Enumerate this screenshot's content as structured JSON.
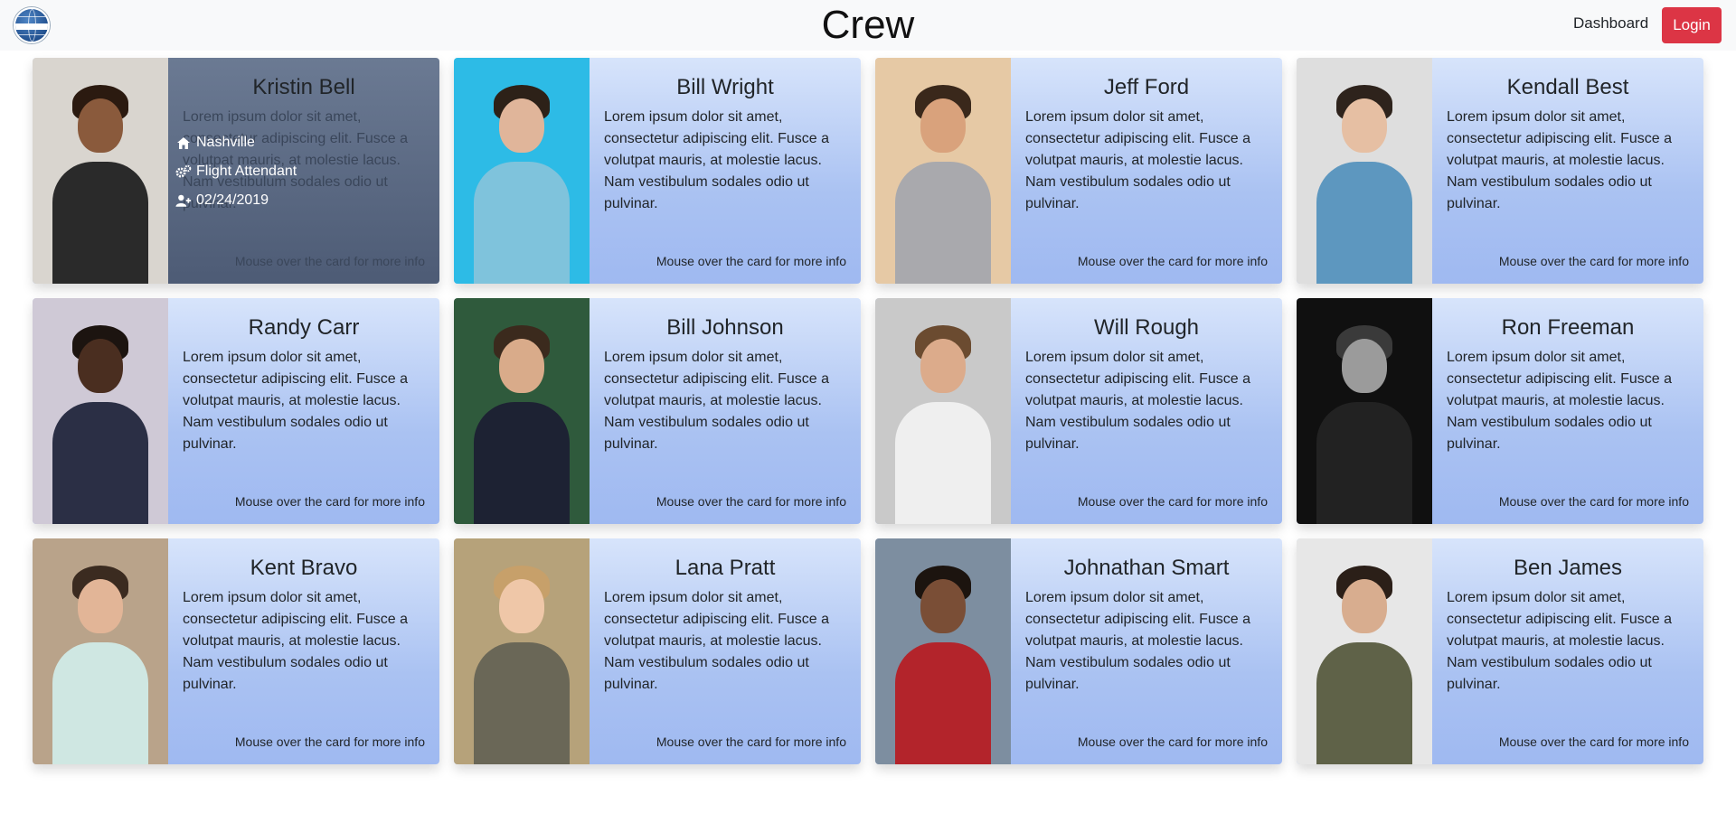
{
  "nav": {
    "title": "Crew",
    "dashboard_label": "Dashboard",
    "login_label": "Login",
    "logo_icon": "pan-am-globe-icon"
  },
  "card_common": {
    "bio": "Lorem ipsum dolor sit amet, consectetur adipiscing elit. Fusce a volutpat mauris, at molestie lacus. Nam vestibulum sodales odio ut pulvinar.",
    "hint": "Mouse over the card for more info"
  },
  "crew": [
    {
      "name": "Kristin Bell",
      "skin": "#8a5a3c",
      "hair": "#2b1a10",
      "shirt": "#2a2a2a",
      "bg": "#d9d5cf",
      "details": {
        "city": "Nashville",
        "role": "Flight Attendant",
        "date": "02/24/2019"
      }
    },
    {
      "name": "Bill Wright",
      "skin": "#e0b59a",
      "hair": "#2d2118",
      "shirt": "#7fc3dc",
      "bg": "#2dbbe6"
    },
    {
      "name": "Jeff Ford",
      "skin": "#d9a27c",
      "hair": "#3a281b",
      "shirt": "#a9a9ad",
      "bg": "#e6c9a5"
    },
    {
      "name": "Kendall Best",
      "skin": "#e6bfa3",
      "hair": "#2e231c",
      "shirt": "#5d97bf",
      "bg": "#dedede"
    },
    {
      "name": "Randy Carr",
      "skin": "#4a2e20",
      "hair": "#1c1410",
      "shirt": "#2b2f45",
      "bg": "#cfc9d6"
    },
    {
      "name": "Bill Johnson",
      "skin": "#d9ab8a",
      "hair": "#3b2a1d",
      "shirt": "#1d2233",
      "bg": "#2f5a3c"
    },
    {
      "name": "Will Rough",
      "skin": "#dcab8b",
      "hair": "#6b4b30",
      "shirt": "#efefef",
      "bg": "#c9c9c9"
    },
    {
      "name": "Ron Freeman",
      "skin": "#9b9b9b",
      "hair": "#3a3a3a",
      "shirt": "#222222",
      "bg": "#101010"
    },
    {
      "name": "Kent Bravo",
      "skin": "#e2b597",
      "hair": "#3b2b20",
      "shirt": "#cfe7e2",
      "bg": "#b9a38a"
    },
    {
      "name": "Lana Pratt",
      "skin": "#efc7a8",
      "hair": "#c7a06a",
      "shirt": "#6a6757",
      "bg": "#b6a27a"
    },
    {
      "name": "Johnathan Smart",
      "skin": "#7a4e36",
      "hair": "#1c140f",
      "shirt": "#b3242b",
      "bg": "#7d8ea0"
    },
    {
      "name": "Ben James",
      "skin": "#d8ad8f",
      "hair": "#2b1f18",
      "shirt": "#5f6248",
      "bg": "#e7e7e7"
    }
  ]
}
